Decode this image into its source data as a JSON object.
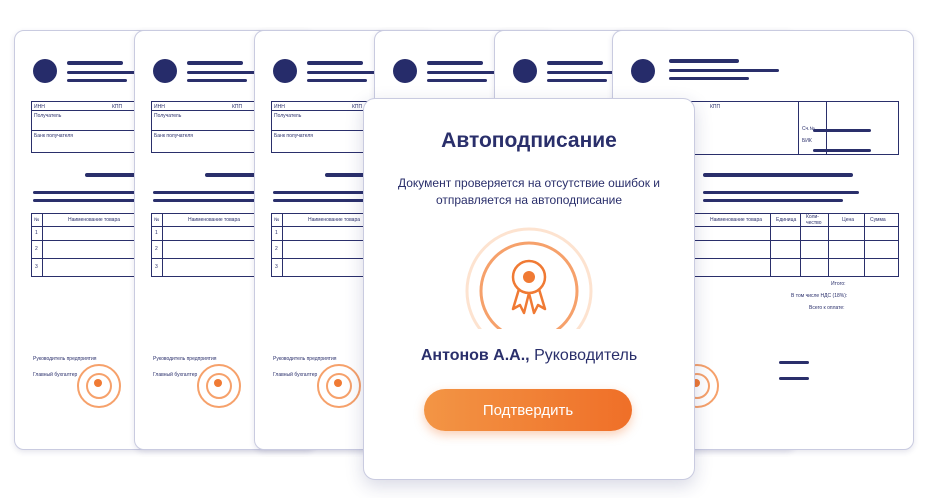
{
  "documents": {
    "inn_label": "ИНН",
    "kpp_label": "КПП",
    "recipient_label": "Получатель",
    "recipient_bank_label": "Банк получателя",
    "col_num": "№",
    "col_name": "Наименование товара",
    "col_unit": "Единица",
    "col_qty": "Коли-чество",
    "col_price": "Цена",
    "col_sum": "Сумма",
    "row1": "1",
    "row2": "2",
    "row3": "3",
    "account_label": "Сч.№",
    "bik_label": "БИК",
    "total_label": "Итого:",
    "vat_label": "В том числе НДС (18%):",
    "to_pay_label": "Всего к оплате:",
    "director_label": "Руководитель предприятия",
    "accountant_label": "Главный бухгалтер"
  },
  "modal": {
    "title": "Автоподписание",
    "description": "Документ проверяется на отсутствие ошибок и отправляется на автоподписание",
    "signer_name": "Антонов А.А.,",
    "signer_role": " Руководитель",
    "confirm_label": "Подтвердить"
  },
  "colors": {
    "navy": "#2a2f6b",
    "accent": "#f07a34"
  },
  "icons": [
    "certificate-seal-icon"
  ]
}
